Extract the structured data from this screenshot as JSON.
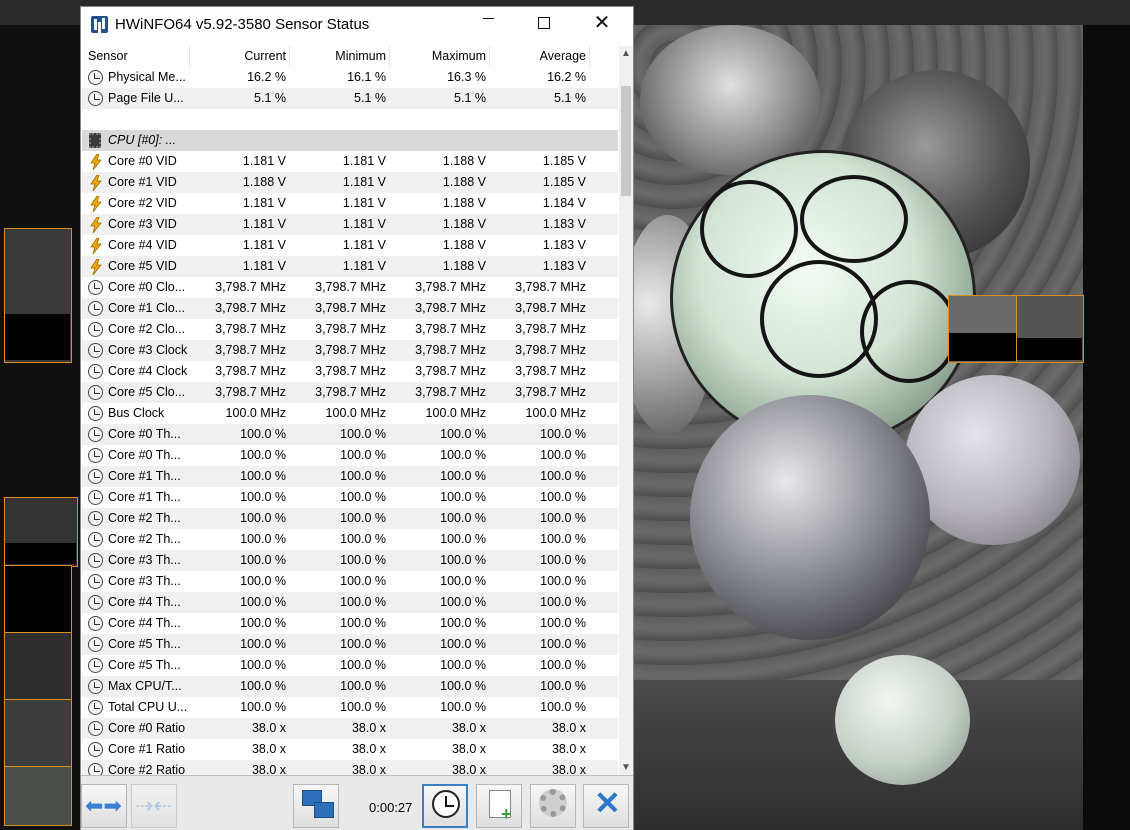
{
  "window": {
    "title": "HWiNFO64 v5.92-3580 Sensor Status"
  },
  "columns": [
    "Sensor",
    "Current",
    "Minimum",
    "Maximum",
    "Average"
  ],
  "rows": [
    {
      "type": "clock",
      "name": "Physical Me...",
      "cur": "16.2 %",
      "min": "16.1 %",
      "max": "16.3 %",
      "avg": "16.2 %"
    },
    {
      "type": "clock",
      "name": "Page File U...",
      "cur": "5.1 %",
      "min": "5.1 %",
      "max": "5.1 %",
      "avg": "5.1 %"
    },
    {
      "type": "blank",
      "name": "",
      "cur": "",
      "min": "",
      "max": "",
      "avg": ""
    },
    {
      "type": "group",
      "name": "CPU [#0]: ...",
      "cur": "",
      "min": "",
      "max": "",
      "avg": ""
    },
    {
      "type": "volt",
      "name": "Core #0 VID",
      "cur": "1.181 V",
      "min": "1.181 V",
      "max": "1.188 V",
      "avg": "1.185 V"
    },
    {
      "type": "volt",
      "name": "Core #1 VID",
      "cur": "1.188 V",
      "min": "1.181 V",
      "max": "1.188 V",
      "avg": "1.185 V"
    },
    {
      "type": "volt",
      "name": "Core #2 VID",
      "cur": "1.181 V",
      "min": "1.181 V",
      "max": "1.188 V",
      "avg": "1.184 V"
    },
    {
      "type": "volt",
      "name": "Core #3 VID",
      "cur": "1.181 V",
      "min": "1.181 V",
      "max": "1.188 V",
      "avg": "1.183 V"
    },
    {
      "type": "volt",
      "name": "Core #4 VID",
      "cur": "1.181 V",
      "min": "1.181 V",
      "max": "1.188 V",
      "avg": "1.183 V"
    },
    {
      "type": "volt",
      "name": "Core #5 VID",
      "cur": "1.181 V",
      "min": "1.181 V",
      "max": "1.188 V",
      "avg": "1.183 V"
    },
    {
      "type": "clock",
      "name": "Core #0 Clo...",
      "cur": "3,798.7 MHz",
      "min": "3,798.7 MHz",
      "max": "3,798.7 MHz",
      "avg": "3,798.7 MHz"
    },
    {
      "type": "clock",
      "name": "Core #1 Clo...",
      "cur": "3,798.7 MHz",
      "min": "3,798.7 MHz",
      "max": "3,798.7 MHz",
      "avg": "3,798.7 MHz"
    },
    {
      "type": "clock",
      "name": "Core #2 Clo...",
      "cur": "3,798.7 MHz",
      "min": "3,798.7 MHz",
      "max": "3,798.7 MHz",
      "avg": "3,798.7 MHz"
    },
    {
      "type": "clock",
      "name": "Core #3 Clock",
      "cur": "3,798.7 MHz",
      "min": "3,798.7 MHz",
      "max": "3,798.7 MHz",
      "avg": "3,798.7 MHz"
    },
    {
      "type": "clock",
      "name": "Core #4 Clock",
      "cur": "3,798.7 MHz",
      "min": "3,798.7 MHz",
      "max": "3,798.7 MHz",
      "avg": "3,798.7 MHz"
    },
    {
      "type": "clock",
      "name": "Core #5 Clo...",
      "cur": "3,798.7 MHz",
      "min": "3,798.7 MHz",
      "max": "3,798.7 MHz",
      "avg": "3,798.7 MHz"
    },
    {
      "type": "clock",
      "name": "Bus Clock",
      "cur": "100.0 MHz",
      "min": "100.0 MHz",
      "max": "100.0 MHz",
      "avg": "100.0 MHz"
    },
    {
      "type": "clock",
      "name": "Core #0 Th...",
      "cur": "100.0 %",
      "min": "100.0 %",
      "max": "100.0 %",
      "avg": "100.0 %"
    },
    {
      "type": "clock",
      "name": "Core #0 Th...",
      "cur": "100.0 %",
      "min": "100.0 %",
      "max": "100.0 %",
      "avg": "100.0 %"
    },
    {
      "type": "clock",
      "name": "Core #1 Th...",
      "cur": "100.0 %",
      "min": "100.0 %",
      "max": "100.0 %",
      "avg": "100.0 %"
    },
    {
      "type": "clock",
      "name": "Core #1 Th...",
      "cur": "100.0 %",
      "min": "100.0 %",
      "max": "100.0 %",
      "avg": "100.0 %"
    },
    {
      "type": "clock",
      "name": "Core #2 Th...",
      "cur": "100.0 %",
      "min": "100.0 %",
      "max": "100.0 %",
      "avg": "100.0 %"
    },
    {
      "type": "clock",
      "name": "Core #2 Th...",
      "cur": "100.0 %",
      "min": "100.0 %",
      "max": "100.0 %",
      "avg": "100.0 %"
    },
    {
      "type": "clock",
      "name": "Core #3 Th...",
      "cur": "100.0 %",
      "min": "100.0 %",
      "max": "100.0 %",
      "avg": "100.0 %"
    },
    {
      "type": "clock",
      "name": "Core #3 Th...",
      "cur": "100.0 %",
      "min": "100.0 %",
      "max": "100.0 %",
      "avg": "100.0 %"
    },
    {
      "type": "clock",
      "name": "Core #4 Th...",
      "cur": "100.0 %",
      "min": "100.0 %",
      "max": "100.0 %",
      "avg": "100.0 %"
    },
    {
      "type": "clock",
      "name": "Core #4 Th...",
      "cur": "100.0 %",
      "min": "100.0 %",
      "max": "100.0 %",
      "avg": "100.0 %"
    },
    {
      "type": "clock",
      "name": "Core #5 Th...",
      "cur": "100.0 %",
      "min": "100.0 %",
      "max": "100.0 %",
      "avg": "100.0 %"
    },
    {
      "type": "clock",
      "name": "Core #5 Th...",
      "cur": "100.0 %",
      "min": "100.0 %",
      "max": "100.0 %",
      "avg": "100.0 %"
    },
    {
      "type": "clock",
      "name": "Max CPU/T...",
      "cur": "100.0 %",
      "min": "100.0 %",
      "max": "100.0 %",
      "avg": "100.0 %"
    },
    {
      "type": "clock",
      "name": "Total CPU U...",
      "cur": "100.0 %",
      "min": "100.0 %",
      "max": "100.0 %",
      "avg": "100.0 %"
    },
    {
      "type": "clock",
      "name": "Core #0 Ratio",
      "cur": "38.0 x",
      "min": "38.0 x",
      "max": "38.0 x",
      "avg": "38.0 x"
    },
    {
      "type": "clock",
      "name": "Core #1 Ratio",
      "cur": "38.0 x",
      "min": "38.0 x",
      "max": "38.0 x",
      "avg": "38.0 x"
    },
    {
      "type": "clock",
      "name": "Core #2 Ratio",
      "cur": "38.0 x",
      "min": "38.0 x",
      "max": "38.0 x",
      "avg": "38.0 x"
    }
  ],
  "toolbar": {
    "timer": "0:00:27",
    "icons": [
      "nav-arrows-icon",
      "nav-arrows-disabled-icon",
      "network-icon",
      "clock-icon",
      "report-add-icon",
      "settings-gear-icon",
      "close-x-icon"
    ]
  }
}
